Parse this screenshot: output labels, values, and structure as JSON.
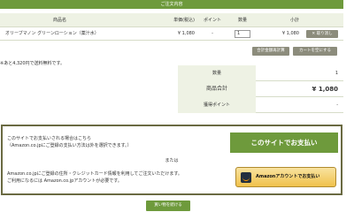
{
  "cart": {
    "title": "ご注文内容",
    "headers": {
      "product": "商品名",
      "price": "単価(税込)",
      "point": "ポイント",
      "qty": "数量",
      "subtotal": "小計"
    },
    "item": {
      "name": "オリーブマノン グリーンローション（薬汁水）",
      "price": "¥ 1,080",
      "point": "-",
      "qty": "1",
      "subtotal": "¥ 1,080",
      "remove_label": "✕ 取り消し"
    },
    "buttons": {
      "recalc": "合計金額再計算",
      "empty": "カートを空にする"
    },
    "shipping_note": "※あと4,320円で送料無料です。"
  },
  "totals": {
    "qty_label": "数量",
    "qty_value": "1",
    "sum_label": "商品合計",
    "sum_value": "¥ 1,080",
    "points_label": "獲得ポイント",
    "points_value": "-"
  },
  "payment": {
    "site_text_1": "このサイトでお支払いされる場合はこちら",
    "site_text_2": "（Amazon.co.jpにご登録の支払い方法は外を選択できます。）",
    "site_button": "このサイトでお支払い",
    "or": "または",
    "amazon_text_1": "Amazon.co.jpにご登録の住所・クレジットカード情報を利用してご注文いただけます。",
    "amazon_text_2": "ご利用になるには Amazon.co.jpアカウントが必要です。",
    "amazon_button": "Amazonアカウントでお支払い"
  },
  "footer": {
    "continue_button": "買い物を続ける"
  }
}
